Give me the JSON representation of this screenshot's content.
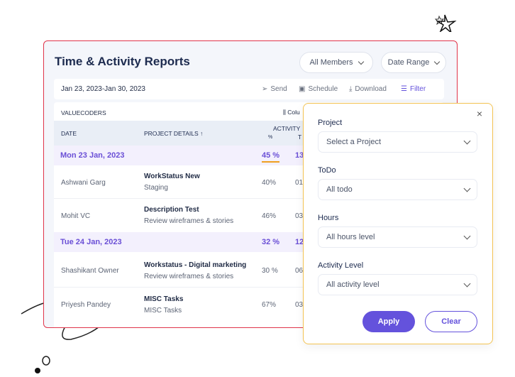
{
  "header": {
    "title": "Time & Activity Reports",
    "members_dropdown": "All Members",
    "date_range_dropdown": "Date Range"
  },
  "toolbar": {
    "date_range": "Jan 23, 2023-Jan 30, 2023",
    "send": "Send",
    "schedule": "Schedule",
    "download": "Download",
    "filter": "Filter"
  },
  "table": {
    "org": "VALUECODERS",
    "columns_button": "Colu",
    "headers": {
      "date": "DATE",
      "project": "PROJECT DETAILS ↑",
      "activity": "ACTIVITY",
      "activity_pct": "%",
      "time": "T"
    },
    "groups": [
      {
        "date": "Mon 23 Jan, 2023",
        "activity": "45 %",
        "time": "13",
        "rows": [
          {
            "name": "Ashwani Garg",
            "project": "WorkStatus New",
            "task": "Staging",
            "activity": "40%",
            "time": "01"
          },
          {
            "name": "Mohit VC",
            "project": "Description Test",
            "task": "Review wireframes & stories",
            "activity": "46%",
            "time": "03"
          }
        ]
      },
      {
        "date": "Tue 24 Jan, 2023",
        "activity": "32 %",
        "time": "12",
        "rows": [
          {
            "name": "Shashikant Owner",
            "project": "Workstatus - Digital marketing",
            "task": "Review wireframes & stories",
            "activity": "30 %",
            "time": "06"
          },
          {
            "name": "Priyesh Pandey",
            "project": "MISC Tasks",
            "task": "MISC Tasks",
            "activity": "67%",
            "time": "03"
          }
        ]
      }
    ]
  },
  "filter_panel": {
    "project_label": "Project",
    "project_value": "Select a Project",
    "todo_label": "ToDo",
    "todo_value": "All todo",
    "hours_label": "Hours",
    "hours_value": "All hours level",
    "activity_label": "Activity Level",
    "activity_value": "All activity level",
    "apply": "Apply",
    "clear": "Clear"
  },
  "colors": {
    "accent": "#6452dc",
    "card_border": "#e0344a",
    "panel_border": "#f3c352",
    "highlight_underline": "#f0a020"
  }
}
